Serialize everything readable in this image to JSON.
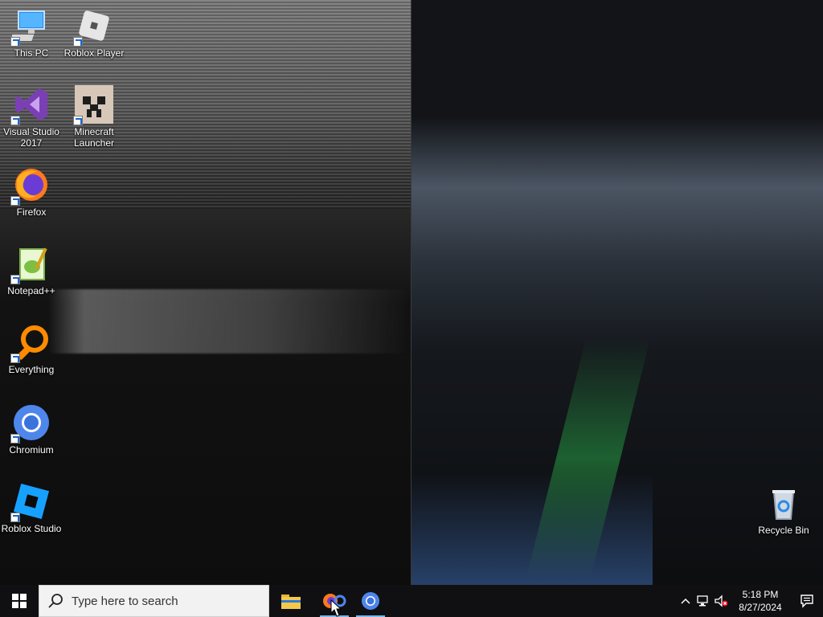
{
  "desktop": {
    "icons": [
      {
        "label": "This PC"
      },
      {
        "label": "Roblox Player"
      },
      {
        "label": "Visual Studio 2017"
      },
      {
        "label": "Minecraft Launcher"
      },
      {
        "label": "Firefox"
      },
      {
        "label": "Notepad++"
      },
      {
        "label": "Everything"
      },
      {
        "label": "Chromium"
      },
      {
        "label": "Roblox Studio"
      },
      {
        "label": "Recycle Bin"
      }
    ]
  },
  "taskbar": {
    "search_placeholder": "Type here to search",
    "pinned": [
      "File Explorer",
      "Firefox",
      "Chromium"
    ],
    "clock": {
      "time": "5:18 PM",
      "date": "8/27/2024"
    }
  }
}
